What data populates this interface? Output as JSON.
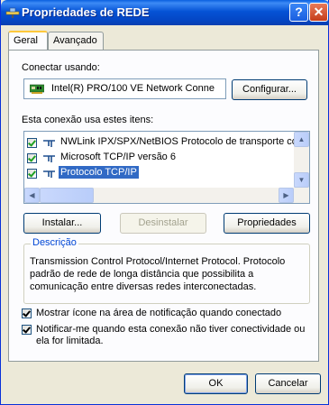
{
  "window": {
    "title": "Propriedades de REDE",
    "help_label": "?",
    "close_label": "✕"
  },
  "tabs": [
    {
      "label": "Geral"
    },
    {
      "label": "Avançado"
    }
  ],
  "connect_using": {
    "label": "Conectar usando:",
    "adapter_name": "Intel(R) PRO/100 VE Network Conne",
    "configure_label": "Configurar..."
  },
  "items_section": {
    "label": "Esta conexão usa estes itens:",
    "items": [
      {
        "label": "NWLink IPX/SPX/NetBIOS Protocolo de transporte co",
        "checked": true
      },
      {
        "label": "Microsoft TCP/IP versão 6",
        "checked": true
      },
      {
        "label": "Protocolo TCP/IP",
        "checked": true,
        "selected": true
      }
    ]
  },
  "actions": {
    "install_label": "Instalar...",
    "uninstall_label": "Desinstalar",
    "properties_label": "Propriedades"
  },
  "description": {
    "legend": "Descrição",
    "text": "Transmission Control Protocol/Internet Protocol. Protocolo padrão de rede de longa distância que possibilita a comunicação entre diversas redes interconectadas."
  },
  "options": [
    {
      "label": "Mostrar ícone na área de notificação quando conectado",
      "checked": true
    },
    {
      "label": "Notificar-me quando esta conexão não tiver conectividade ou ela for limitada.",
      "checked": true
    }
  ],
  "footer": {
    "ok_label": "OK",
    "cancel_label": "Cancelar"
  },
  "colors": {
    "title_bar": "#0553d6",
    "selection": "#316ac5",
    "legend_text": "#0046d5",
    "dialog_bg": "#ece9d8"
  },
  "icons": {
    "adapter": "network-card-icon",
    "protocol": "network-protocol-icon"
  }
}
